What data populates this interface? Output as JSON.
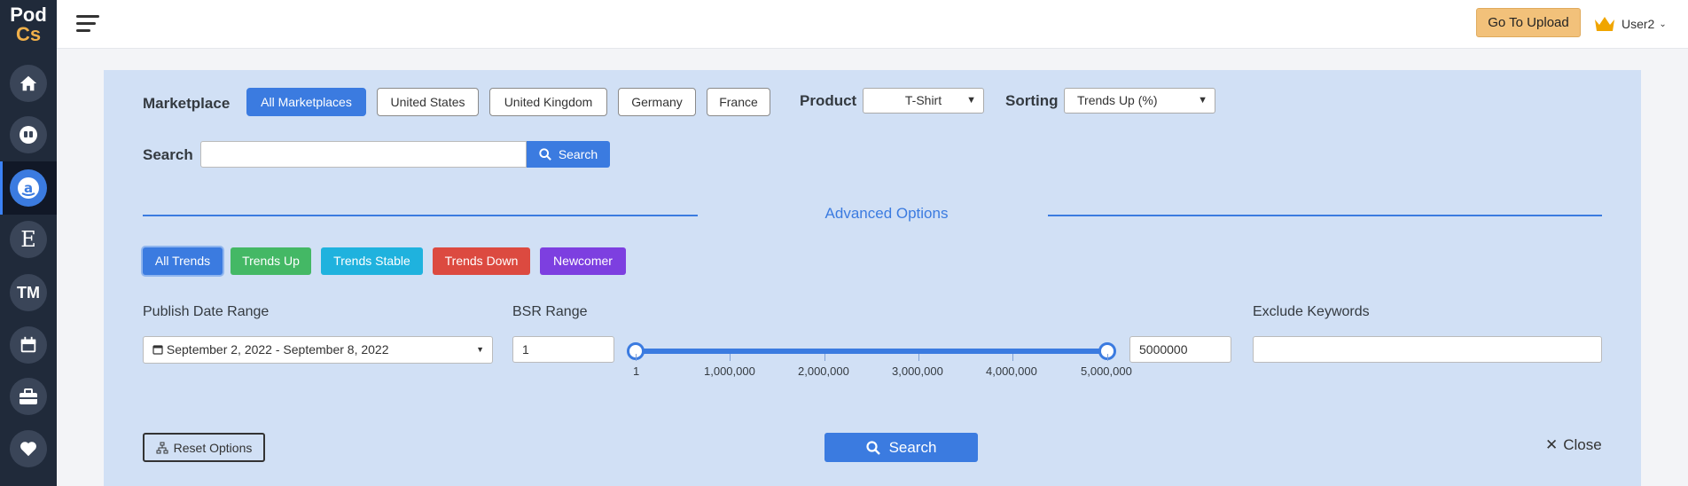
{
  "logo": {
    "line1": "Pod",
    "line2": "Cs"
  },
  "sidebar": {
    "items": [
      {
        "icon": "home-icon"
      },
      {
        "icon": "redbubble-icon"
      },
      {
        "icon": "amazon-icon",
        "active": true
      },
      {
        "icon": "etsy-icon",
        "text": "E"
      },
      {
        "icon": "trademark-icon",
        "text": "TM"
      },
      {
        "icon": "calendar-icon"
      },
      {
        "icon": "toolbox-icon"
      },
      {
        "icon": "heart-icon"
      }
    ]
  },
  "header": {
    "upload_label": "Go To Upload",
    "user_label": "User2",
    "accent_upload": "#f2c17a"
  },
  "filters": {
    "marketplace_label": "Marketplace",
    "marketplaces": [
      "All Marketplaces",
      "United States",
      "United Kingdom",
      "Germany",
      "France"
    ],
    "active_marketplace": "All Marketplaces",
    "product_label": "Product",
    "product_value": "T-Shirt",
    "sorting_label": "Sorting",
    "sorting_value": "Trends Up (%)",
    "search_label": "Search",
    "search_value": "",
    "search_button": "Search"
  },
  "advanced": {
    "title": "Advanced Options",
    "trends": [
      {
        "label": "All Trends",
        "color": "#3b7be0"
      },
      {
        "label": "Trends Up",
        "color": "#44b865"
      },
      {
        "label": "Trends Stable",
        "color": "#1fb2de"
      },
      {
        "label": "Trends Down",
        "color": "#dc4a40"
      },
      {
        "label": "Newcomer",
        "color": "#7d3fe0"
      }
    ],
    "publish_date_label": "Publish Date Range",
    "publish_date_value": "September 2, 2022 - September 8, 2022",
    "bsr_label": "BSR Range",
    "bsr_min": "1",
    "bsr_max": "5000000",
    "bsr_ticks": [
      "1",
      "1,000,000",
      "2,000,000",
      "3,000,000",
      "4,000,000",
      "5,000,000"
    ],
    "exclude_label": "Exclude Keywords",
    "exclude_value": ""
  },
  "actions": {
    "reset_label": "Reset Options",
    "search_label": "Search",
    "close_label": "Close"
  },
  "colors": {
    "primary": "#3b7be0",
    "panel": "#d1e0f5",
    "sidebar": "#202a3a"
  }
}
